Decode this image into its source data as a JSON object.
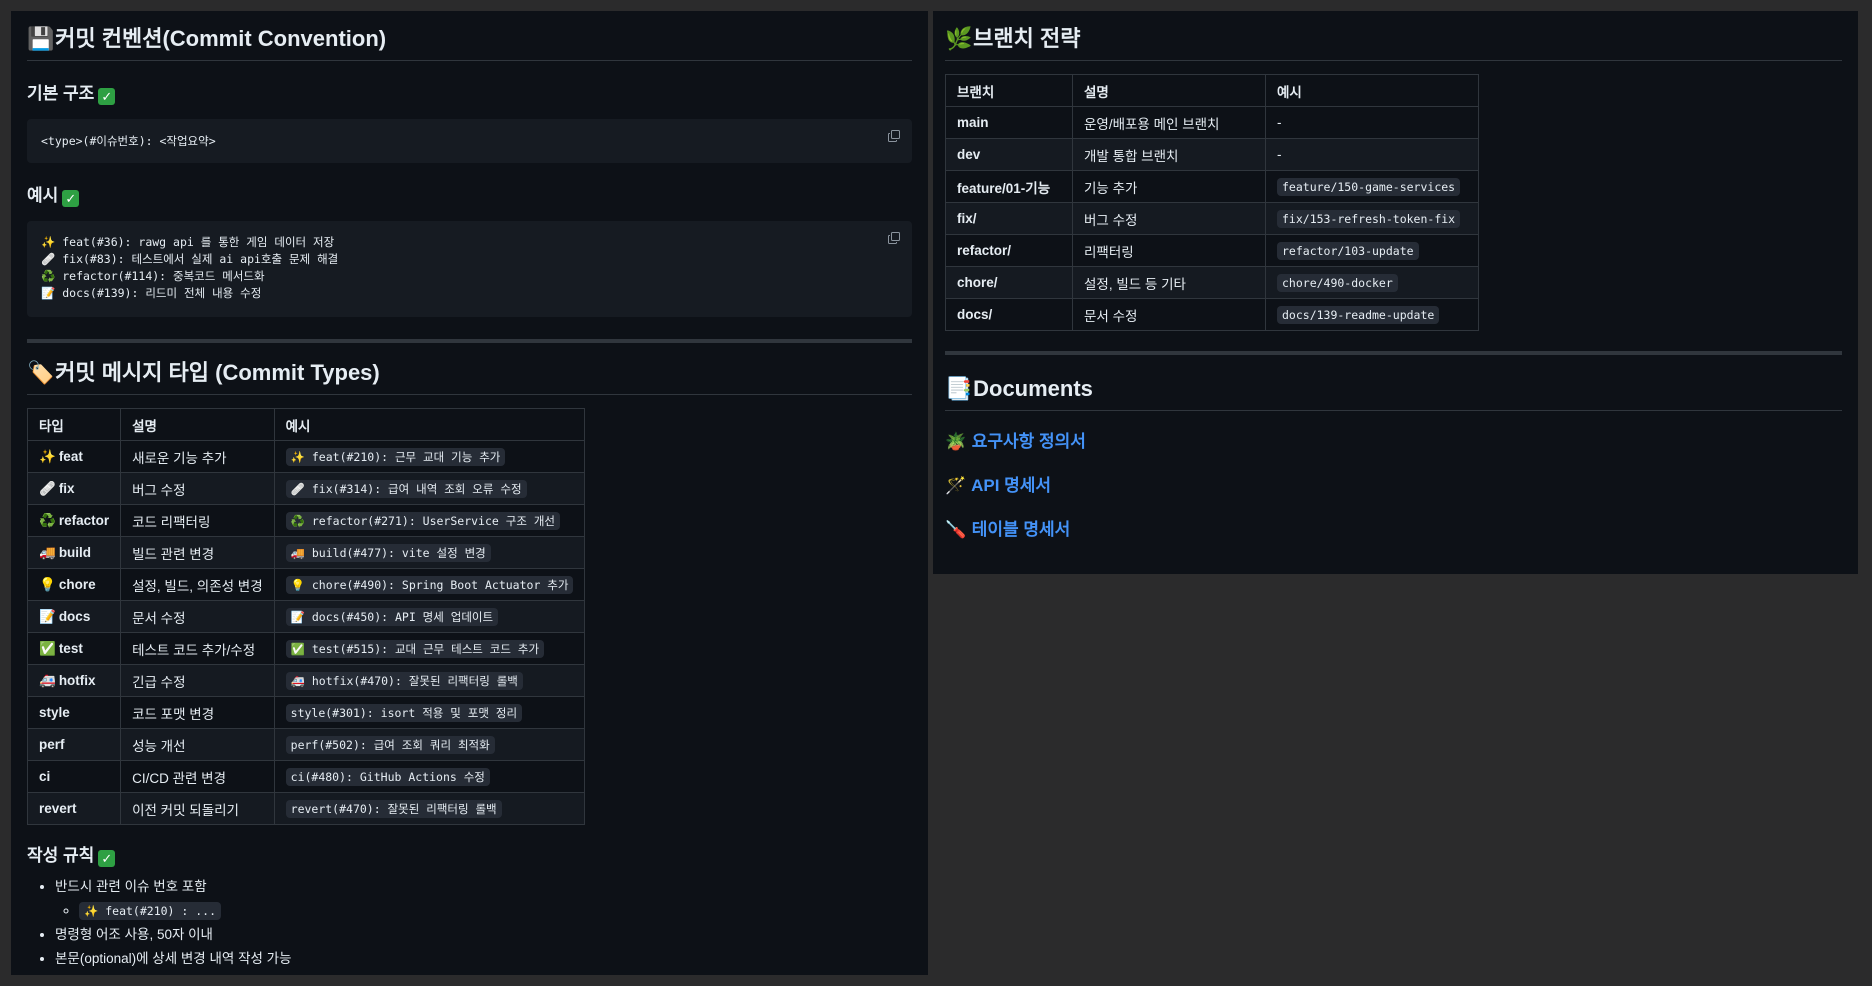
{
  "left": {
    "commit_convention": {
      "emoji": "💾",
      "title": "커밋 컨벤션(Commit Convention)",
      "basic_structure": {
        "title": "기본 구조",
        "code": "<type>(#이슈번호): <작업요약>"
      },
      "example": {
        "title": "예시",
        "lines": [
          "✨ feat(#36): rawg api 를 통한 게임 데이터 저장",
          "🩹 fix(#83): 테스트에서 실제 ai api호출 문제 해결",
          "♻️ refactor(#114): 중복코드 메서드화",
          "📝 docs(#139): 리드미 전체 내용 수정"
        ]
      }
    },
    "commit_types": {
      "emoji": "🏷️",
      "title": "커밋 메시지 타입 (Commit Types)",
      "headers": [
        "타입",
        "설명",
        "예시"
      ],
      "rows": [
        {
          "emoji": "✨",
          "type": "feat",
          "desc": "새로운 기능 추가",
          "example": "✨ feat(#210): 근무 교대 기능 추가"
        },
        {
          "emoji": "🩹",
          "type": "fix",
          "desc": "버그 수정",
          "example": "🩹 fix(#314): 급여 내역 조회 오류 수정"
        },
        {
          "emoji": "♻️",
          "type": "refactor",
          "desc": "코드 리팩터링",
          "example": "♻️ refactor(#271): UserService 구조 개선"
        },
        {
          "emoji": "🚚",
          "type": "build",
          "desc": "빌드 관련 변경",
          "example": "🚚 build(#477): vite 설정 변경"
        },
        {
          "emoji": "💡",
          "type": "chore",
          "desc": "설정, 빌드, 의존성 변경",
          "example": "💡 chore(#490): Spring Boot Actuator 추가"
        },
        {
          "emoji": "📝",
          "type": "docs",
          "desc": "문서 수정",
          "example": "📝 docs(#450): API 명세 업데이트"
        },
        {
          "emoji": "✅",
          "type": "test",
          "desc": "테스트 코드 추가/수정",
          "example": "✅ test(#515): 교대 근무 테스트 코드 추가"
        },
        {
          "emoji": "🚑",
          "type": "hotfix",
          "desc": "긴급 수정",
          "example": "🚑 hotfix(#470): 잘못된 리팩터링 롤백"
        },
        {
          "emoji": "",
          "type": "style",
          "desc": "코드 포맷 변경",
          "example": "style(#301): isort 적용 및 포맷 정리"
        },
        {
          "emoji": "",
          "type": "perf",
          "desc": "성능 개선",
          "example": "perf(#502): 급여 조회 쿼리 최적화"
        },
        {
          "emoji": "",
          "type": "ci",
          "desc": "CI/CD 관련 변경",
          "example": "ci(#480): GitHub Actions 수정"
        },
        {
          "emoji": "",
          "type": "revert",
          "desc": "이전 커밋 되돌리기",
          "example": "revert(#470): 잘못된 리팩터링 롤백"
        }
      ]
    },
    "writing_rules": {
      "title": "작성 규칙",
      "items": [
        {
          "text": "반드시 관련 이슈 번호 포함",
          "sub": "✨ feat(#210) : ..."
        },
        {
          "text": "명령형 어조 사용, 50자 이내"
        },
        {
          "text": "본문(optional)에 상세 변경 내역 작성 가능"
        }
      ]
    }
  },
  "right": {
    "branch_strategy": {
      "emoji": "🌿",
      "title": "브랜치 전략",
      "headers": [
        "브랜치",
        "설명",
        "예시"
      ],
      "rows": [
        {
          "branch": "main",
          "desc": "운영/배포용 메인 브랜치",
          "example": "-",
          "is_code": false
        },
        {
          "branch": "dev",
          "desc": "개발 통합 브랜치",
          "example": "-",
          "is_code": false
        },
        {
          "branch": "feature/01-기능",
          "desc": "기능 추가",
          "example": "feature/150-game-services",
          "is_code": true
        },
        {
          "branch": "fix/",
          "desc": "버그 수정",
          "example": "fix/153-refresh-token-fix",
          "is_code": true
        },
        {
          "branch": "refactor/",
          "desc": "리팩터링",
          "example": "refactor/103-update",
          "is_code": true
        },
        {
          "branch": "chore/",
          "desc": "설정, 빌드 등 기타",
          "example": "chore/490-docker",
          "is_code": true
        },
        {
          "branch": "docs/",
          "desc": "문서 수정",
          "example": "docs/139-readme-update",
          "is_code": true
        }
      ]
    },
    "documents": {
      "emoji": "📑",
      "title": "Documents",
      "links": [
        {
          "emoji": "🪴",
          "label": "요구사항 정의서"
        },
        {
          "emoji": "🪄",
          "label": "API 명세서"
        },
        {
          "emoji": "🪛",
          "label": "테이블 명세서"
        }
      ]
    }
  },
  "icons": {
    "copy": "copy-icon",
    "check": "check-mark-icon"
  },
  "colors": {
    "background": "#0d1117",
    "link": "#4493f8",
    "check": "#2ea043",
    "border": "#30363d"
  }
}
